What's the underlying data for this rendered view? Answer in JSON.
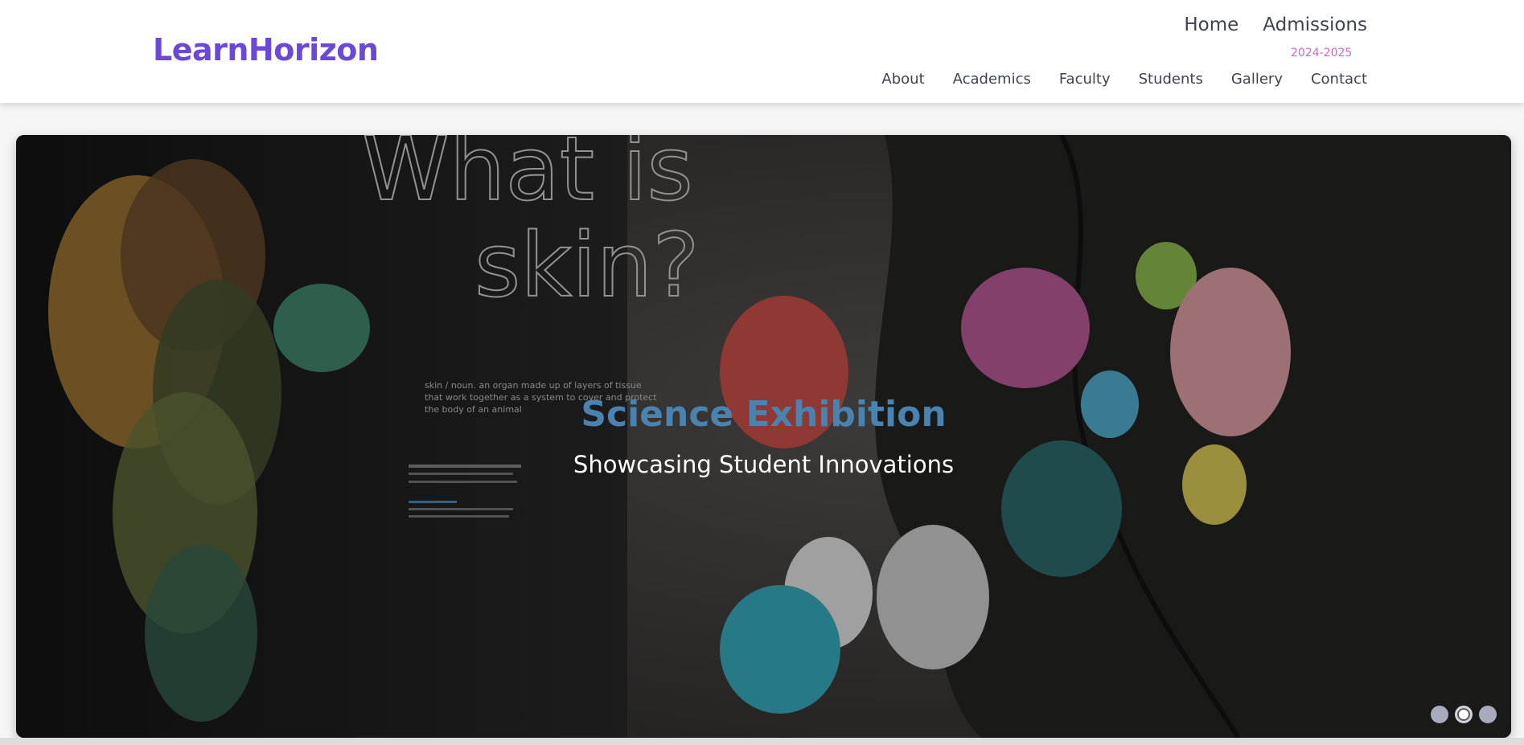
{
  "header": {
    "logo": "LearnHorizon",
    "primary_nav": [
      {
        "label": "Home"
      },
      {
        "label": "Admissions",
        "sub": "2024-2025"
      }
    ],
    "secondary_nav": [
      {
        "label": "About"
      },
      {
        "label": "Academics"
      },
      {
        "label": "Faculty"
      },
      {
        "label": "Students"
      },
      {
        "label": "Gallery"
      },
      {
        "label": "Contact"
      }
    ]
  },
  "hero": {
    "title": "Science Exhibition",
    "subtitle": "Showcasing Student Innovations",
    "slides_count": 3,
    "active_slide": 2,
    "image": {
      "heading_lines": [
        "What is",
        "skin?"
      ],
      "definition": [
        "skin / noun. an organ made up of layers of tissue",
        "that work together as a system to cover and protect",
        "the body of an animal"
      ]
    }
  },
  "colors": {
    "brand": "#6c48d8",
    "nav_text": "#3d4350",
    "admissions_sub": "#d067d0",
    "hero_title": "#4a82b0"
  }
}
